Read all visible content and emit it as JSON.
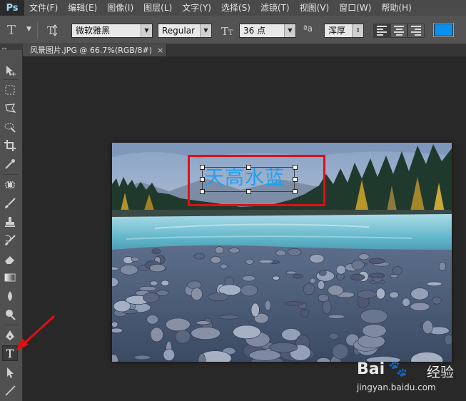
{
  "app": {
    "logo": "Ps"
  },
  "menu": {
    "items": [
      "文件(F)",
      "编辑(E)",
      "图像(I)",
      "图层(L)",
      "文字(Y)",
      "选择(S)",
      "滤镜(T)",
      "视图(V)",
      "窗口(W)",
      "帮助(H)"
    ]
  },
  "options": {
    "font_family": "微软雅黑",
    "font_style": "Regular",
    "font_size": "36 点",
    "aa_label": "ªa",
    "antialias": "浑厚",
    "text_color": "#0a8ff0"
  },
  "document": {
    "tab_title": "风景图片.JPG @ 66.7%(RGB/8#)",
    "tab_close": "×"
  },
  "canvas": {
    "text": "天高水蓝",
    "text_color": "#1ea0f0",
    "highlight_color": "#e00f14"
  },
  "toolbar": {
    "selected_tool": "type-tool",
    "tools": [
      "move-tool",
      "marquee-tool",
      "lasso-tool",
      "quick-selection-tool",
      "crop-tool",
      "eyedropper-tool",
      "healing-brush-tool",
      "brush-tool",
      "clone-stamp-tool",
      "history-brush-tool",
      "eraser-tool",
      "gradient-tool",
      "blur-tool",
      "dodge-tool",
      "pen-tool",
      "type-tool",
      "path-selection-tool",
      "line-tool"
    ]
  },
  "watermark": {
    "brand": "Bai",
    "brand_cn": "经验",
    "url": "jingyan.baidu.com"
  }
}
